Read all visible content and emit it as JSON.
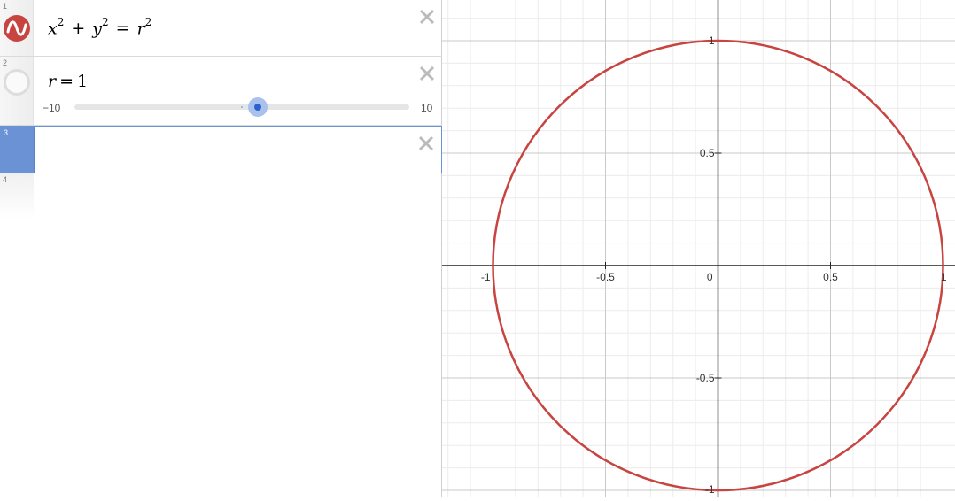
{
  "expressions": [
    {
      "number": "1",
      "latex": {
        "x": "x",
        "x_exp": "2",
        "plus": "+",
        "y": "y",
        "y_exp": "2",
        "eq": "=",
        "r": "r",
        "r_exp": "2"
      },
      "color": "#c74440",
      "icon": "series-wave-icon",
      "delete_icon": "close-icon"
    },
    {
      "number": "2",
      "latex": {
        "var": "r",
        "eq": "=",
        "value": "1"
      },
      "slider": {
        "min": "−10",
        "max": "10",
        "value": 1
      },
      "icon": "hidden-circle-icon",
      "delete_icon": "close-icon"
    },
    {
      "number": "3",
      "empty": true,
      "active": true,
      "delete_icon": "close-icon"
    },
    {
      "number": "4",
      "empty": true
    }
  ],
  "graph": {
    "x_ticks": [
      "-1",
      "-0.5",
      "0",
      "0.5",
      "1"
    ],
    "y_ticks": [
      "1",
      "0.5",
      "-0.5",
      "-1"
    ],
    "curve_color": "#c74440",
    "circle_radius": 1
  }
}
